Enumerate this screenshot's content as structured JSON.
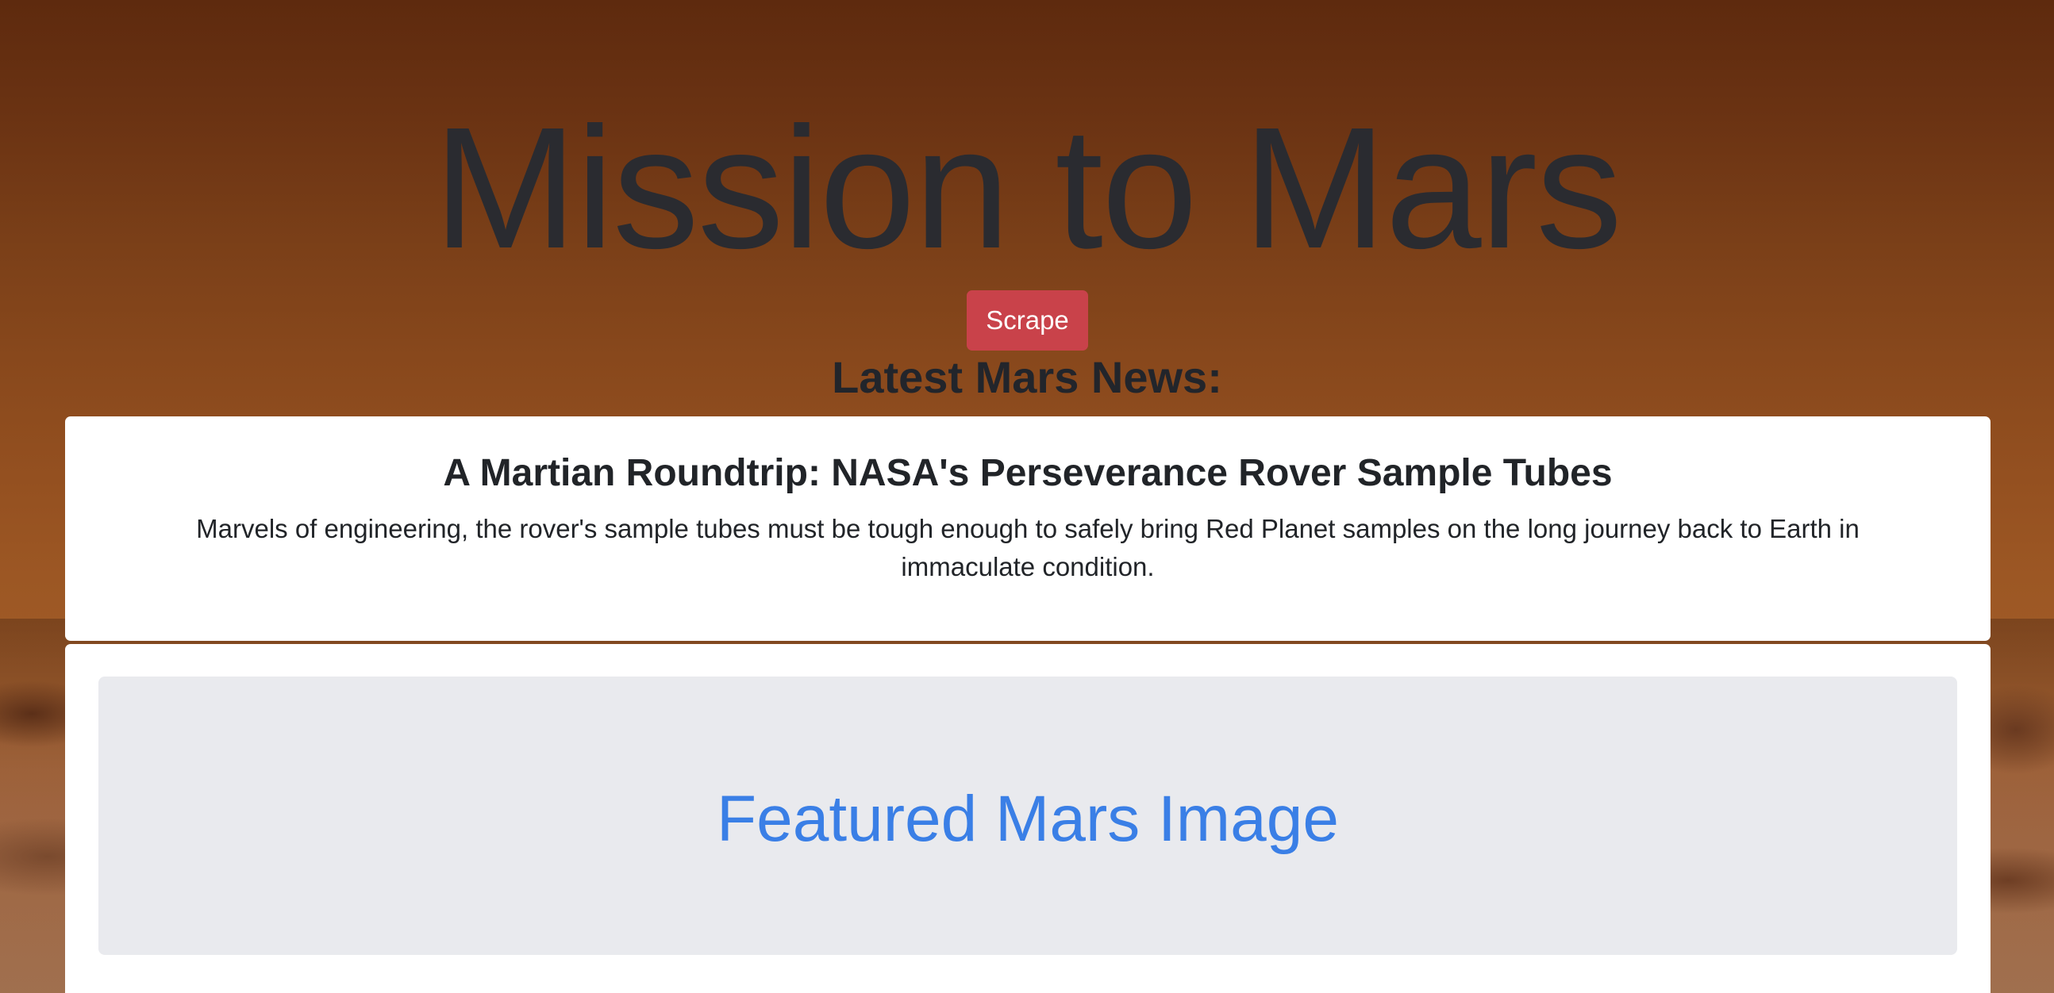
{
  "header": {
    "title": "Mission to Mars",
    "scrape_label": "Scrape"
  },
  "news": {
    "section_heading": "Latest Mars News:",
    "title": "A Martian Roundtrip: NASA's Perseverance Rover Sample Tubes",
    "teaser": "Marvels of engineering, the rover's sample tubes must be tough enough to safely bring Red Planet samples on the long journey back to Earth in immaculate condition."
  },
  "featured": {
    "heading": "Featured Mars Image"
  },
  "colors": {
    "scrape_button": "#c9424a",
    "featured_heading": "#3a7fe6",
    "featured_panel": "#e9eaee",
    "title_text": "#2a2b30"
  }
}
